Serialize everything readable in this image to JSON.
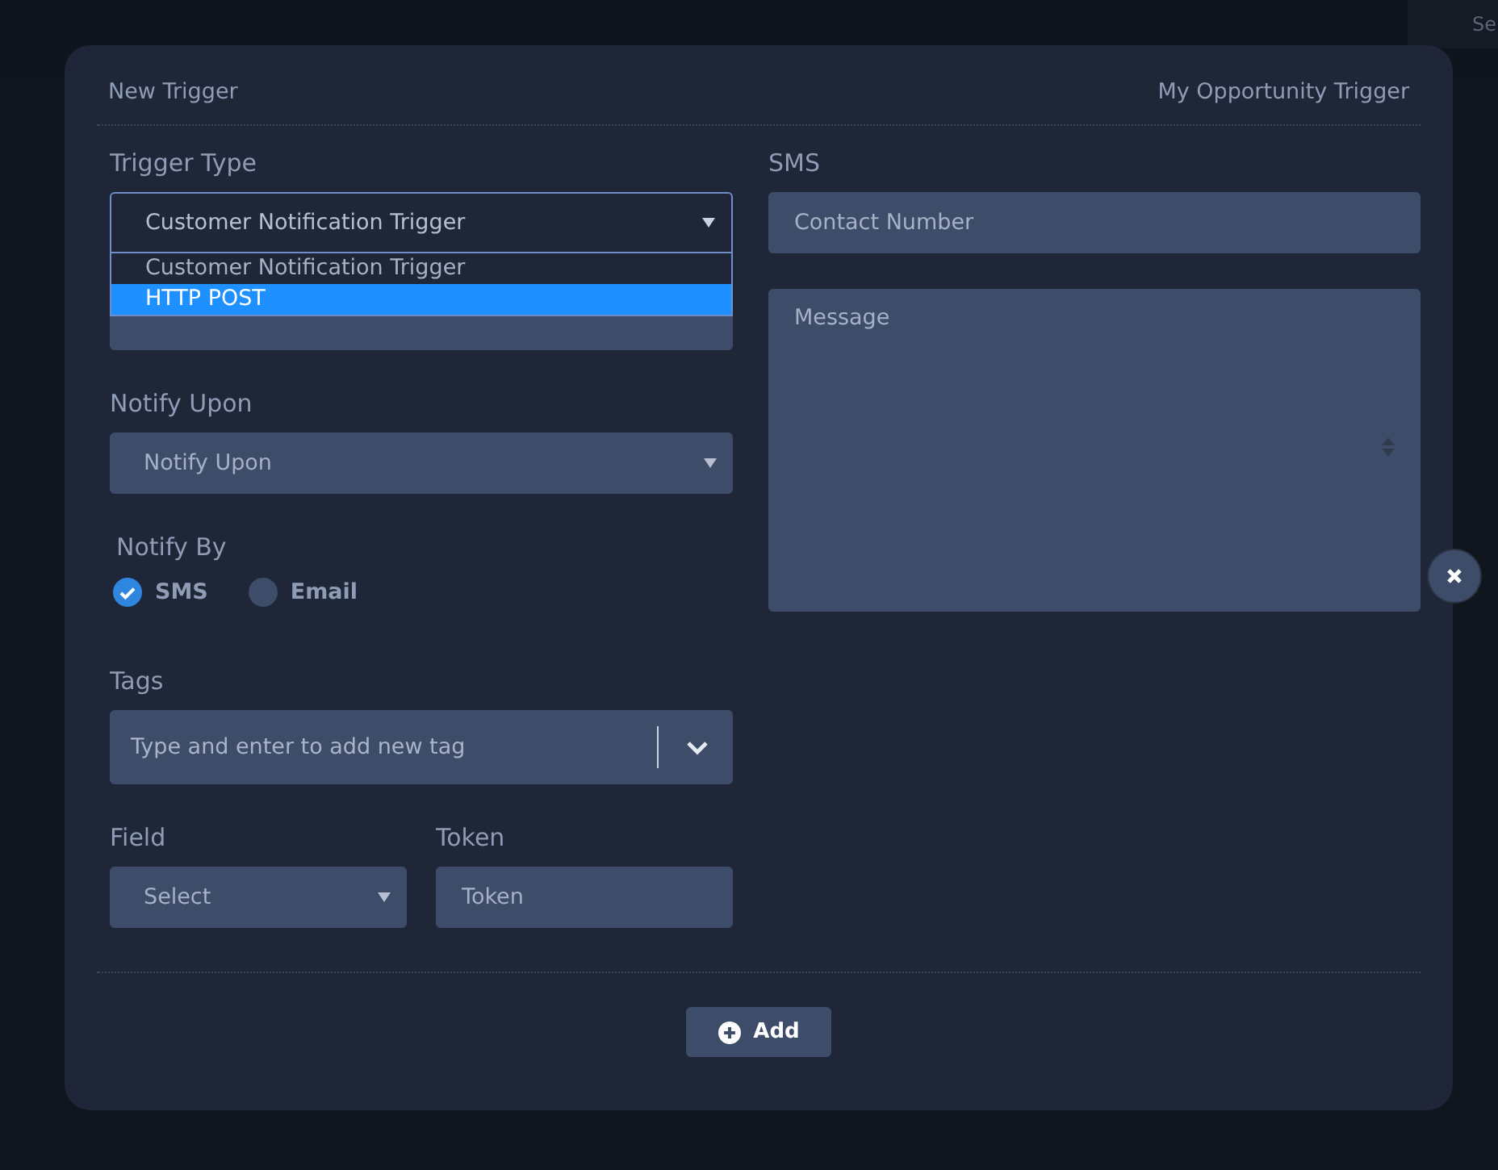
{
  "background": {
    "search_placeholder": "Se"
  },
  "modal": {
    "title": "New Trigger",
    "subtitle": "My Opportunity Trigger"
  },
  "trigger_type": {
    "label": "Trigger Type",
    "value": "Customer Notification Trigger",
    "expanded": true,
    "options": [
      {
        "label": "Customer Notification Trigger",
        "highlighted": false
      },
      {
        "label": "HTTP POST",
        "highlighted": true
      }
    ]
  },
  "notify_upon": {
    "label": "Notify Upon",
    "placeholder": "Notify Upon"
  },
  "notify_by": {
    "label": "Notify By",
    "options": [
      {
        "label": "SMS",
        "checked": true
      },
      {
        "label": "Email",
        "checked": false
      }
    ]
  },
  "tags": {
    "label": "Tags",
    "placeholder": "Type and enter to add new tag"
  },
  "field": {
    "label": "Field",
    "placeholder": "Select"
  },
  "token": {
    "label": "Token",
    "placeholder": "Token"
  },
  "sms": {
    "label": "SMS",
    "contact_placeholder": "Contact Number",
    "message_placeholder": "Message"
  },
  "add_button": "Add"
}
